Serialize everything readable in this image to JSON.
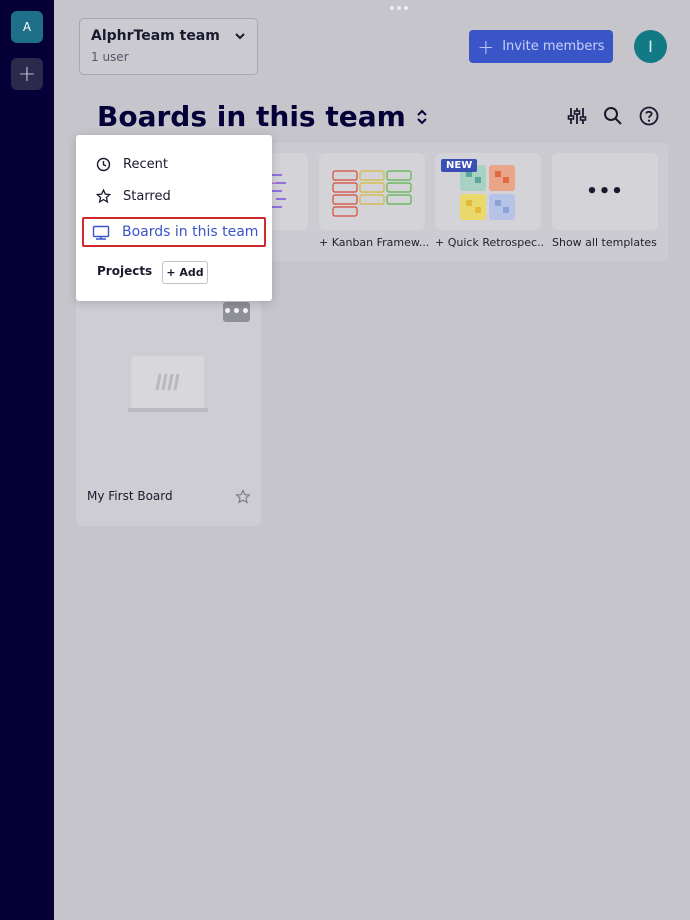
{
  "sidebar": {
    "team_initial": "A",
    "add_label": "+"
  },
  "team_switcher": {
    "name": "AlphrTeam team",
    "users": "1 user"
  },
  "header": {
    "invite_label": "Invite members",
    "user_initial": "I"
  },
  "page": {
    "title": "Boards in this team"
  },
  "templates": [
    {
      "label": "+ Kanban Framew..."
    },
    {
      "label": "+ Quick Retrospec...",
      "badge": "NEW"
    },
    {
      "label": "Show all templates",
      "dots": "•••"
    }
  ],
  "board": {
    "name": "My First Board",
    "menu": "•••"
  },
  "dropdown": {
    "items": [
      {
        "label": "Recent",
        "icon": "clock-icon"
      },
      {
        "label": "Starred",
        "icon": "star-icon"
      }
    ],
    "selected": {
      "label": "Boards in this team",
      "icon": "board-icon"
    },
    "projects_label": "Projects",
    "add_label": "+ Add"
  },
  "colors": {
    "accent": "#3a55c8",
    "rail": "#050038",
    "highlight": "#d12a2a"
  }
}
